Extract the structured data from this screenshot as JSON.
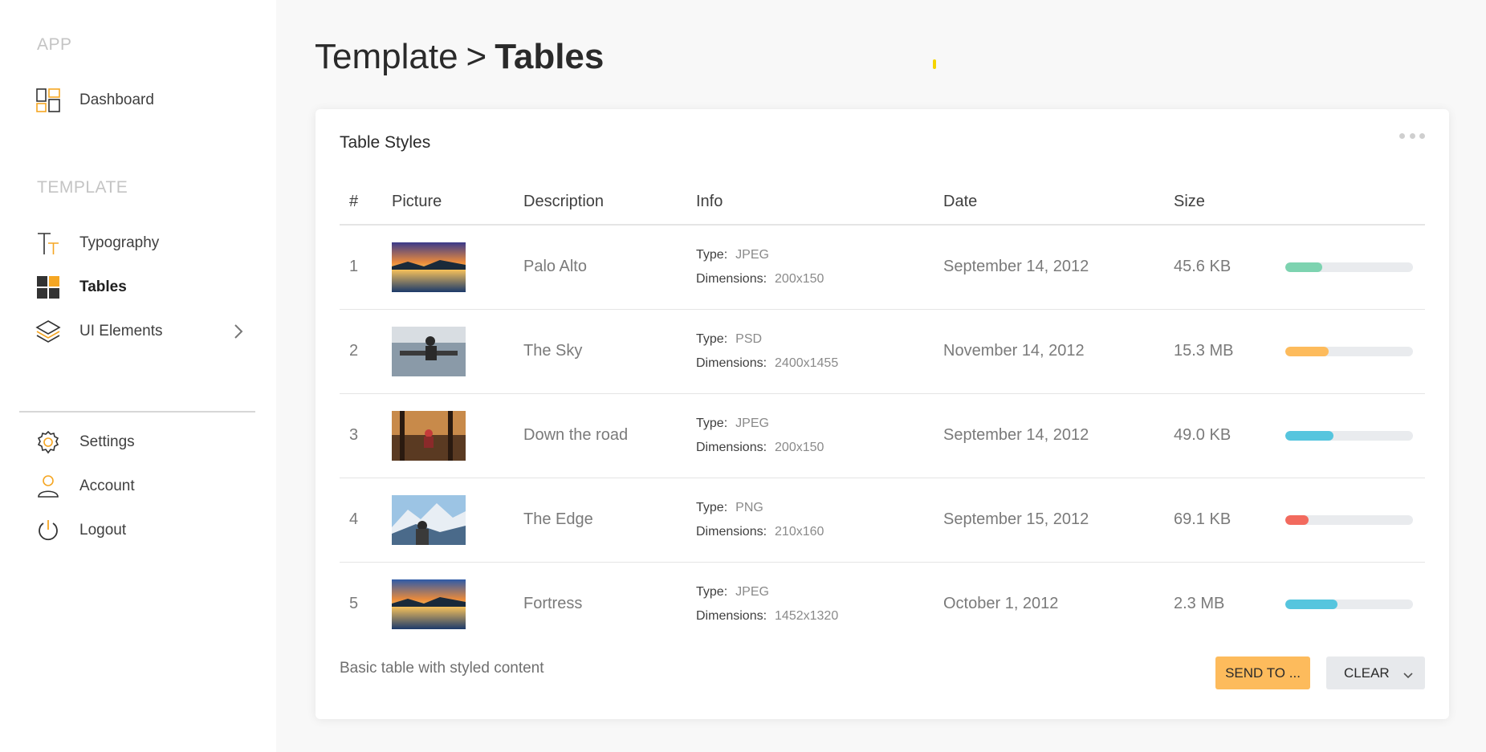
{
  "sidebar": {
    "sections": {
      "app": "APP",
      "template": "TEMPLATE"
    },
    "items": [
      {
        "label": "Dashboard",
        "icon": "dashboard-icon"
      },
      {
        "label": "Typography",
        "icon": "typography-icon"
      },
      {
        "label": "Tables",
        "icon": "tables-icon",
        "active": true
      },
      {
        "label": "UI Elements",
        "icon": "layers-icon"
      },
      {
        "label": "Settings",
        "icon": "gear-icon"
      },
      {
        "label": "Account",
        "icon": "user-icon"
      },
      {
        "label": "Logout",
        "icon": "power-icon"
      }
    ]
  },
  "header": {
    "crumb": "Template",
    "separator": ">",
    "current": "Tables"
  },
  "card": {
    "title": "Table Styles",
    "columns": [
      "#",
      "Picture",
      "Description",
      "Info",
      "Date",
      "Size"
    ],
    "rows": [
      {
        "num": "1",
        "desc": "Palo Alto",
        "type": "JPEG",
        "dims": "200x150",
        "date": "September 14, 2012",
        "size": "45.6 KB",
        "progress": 0.29,
        "color": "#7dd3b0"
      },
      {
        "num": "2",
        "desc": "The Sky",
        "type": "PSD",
        "dims": "2400x1455",
        "date": "November 14, 2012",
        "size": "15.3 MB",
        "progress": 0.34,
        "color": "#fdbb5c"
      },
      {
        "num": "3",
        "desc": "Down the road",
        "type": "JPEG",
        "dims": "200x150",
        "date": "September 14, 2012",
        "size": "49.0 KB",
        "progress": 0.38,
        "color": "#56c5de"
      },
      {
        "num": "4",
        "desc": "The Edge",
        "type": "PNG",
        "dims": "210x160",
        "date": "September 15, 2012",
        "size": "69.1 KB",
        "progress": 0.18,
        "color": "#f26a5e"
      },
      {
        "num": "5",
        "desc": "Fortress",
        "type": "JPEG",
        "dims": "1452x1320",
        "date": "October 1, 2012",
        "size": "2.3 MB",
        "progress": 0.41,
        "color": "#56c5de"
      }
    ],
    "info_labels": {
      "type": "Type:",
      "dims": "Dimensions:"
    },
    "footer_note": "Basic table with styled content",
    "send_label": "SEND TO ...",
    "clear_label": "CLEAR"
  },
  "colors": {
    "accent": "#f5a623",
    "send_button": "#fdbb5c",
    "clear_button": "#e7e9ec"
  }
}
